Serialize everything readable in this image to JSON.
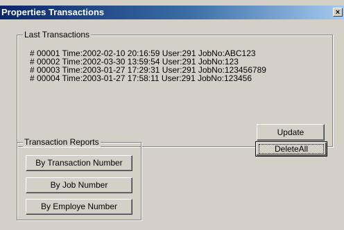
{
  "window": {
    "title": "Properties Transactions",
    "close_glyph": "×"
  },
  "last_transactions": {
    "title": "Last Transactions",
    "lines": [
      "# 00001 Time:2002-02-10 20:16:59 User:291 JobNo:ABC123",
      "# 00002 Time:2002-03-30 13:59:54 User:291 JobNo:123",
      "# 00003 Time:2003-01-27 17:29:31 User:291 JobNo:123456789",
      "# 00004 Time:2003-01-27 17:58:11 User:291 JobNo:123456"
    ],
    "update_label": "Update"
  },
  "transaction_reports": {
    "title": "Transaction Reports",
    "by_transaction_number_label": "By Transaction Number",
    "by_job_number_label": "By Job Number",
    "by_employe_number_label": "By Employe Number"
  },
  "delete_all_label": "DeleteAll",
  "colors": {
    "face": "#d4d0c8",
    "title_start": "#0a246a",
    "title_end": "#a6caf0"
  }
}
